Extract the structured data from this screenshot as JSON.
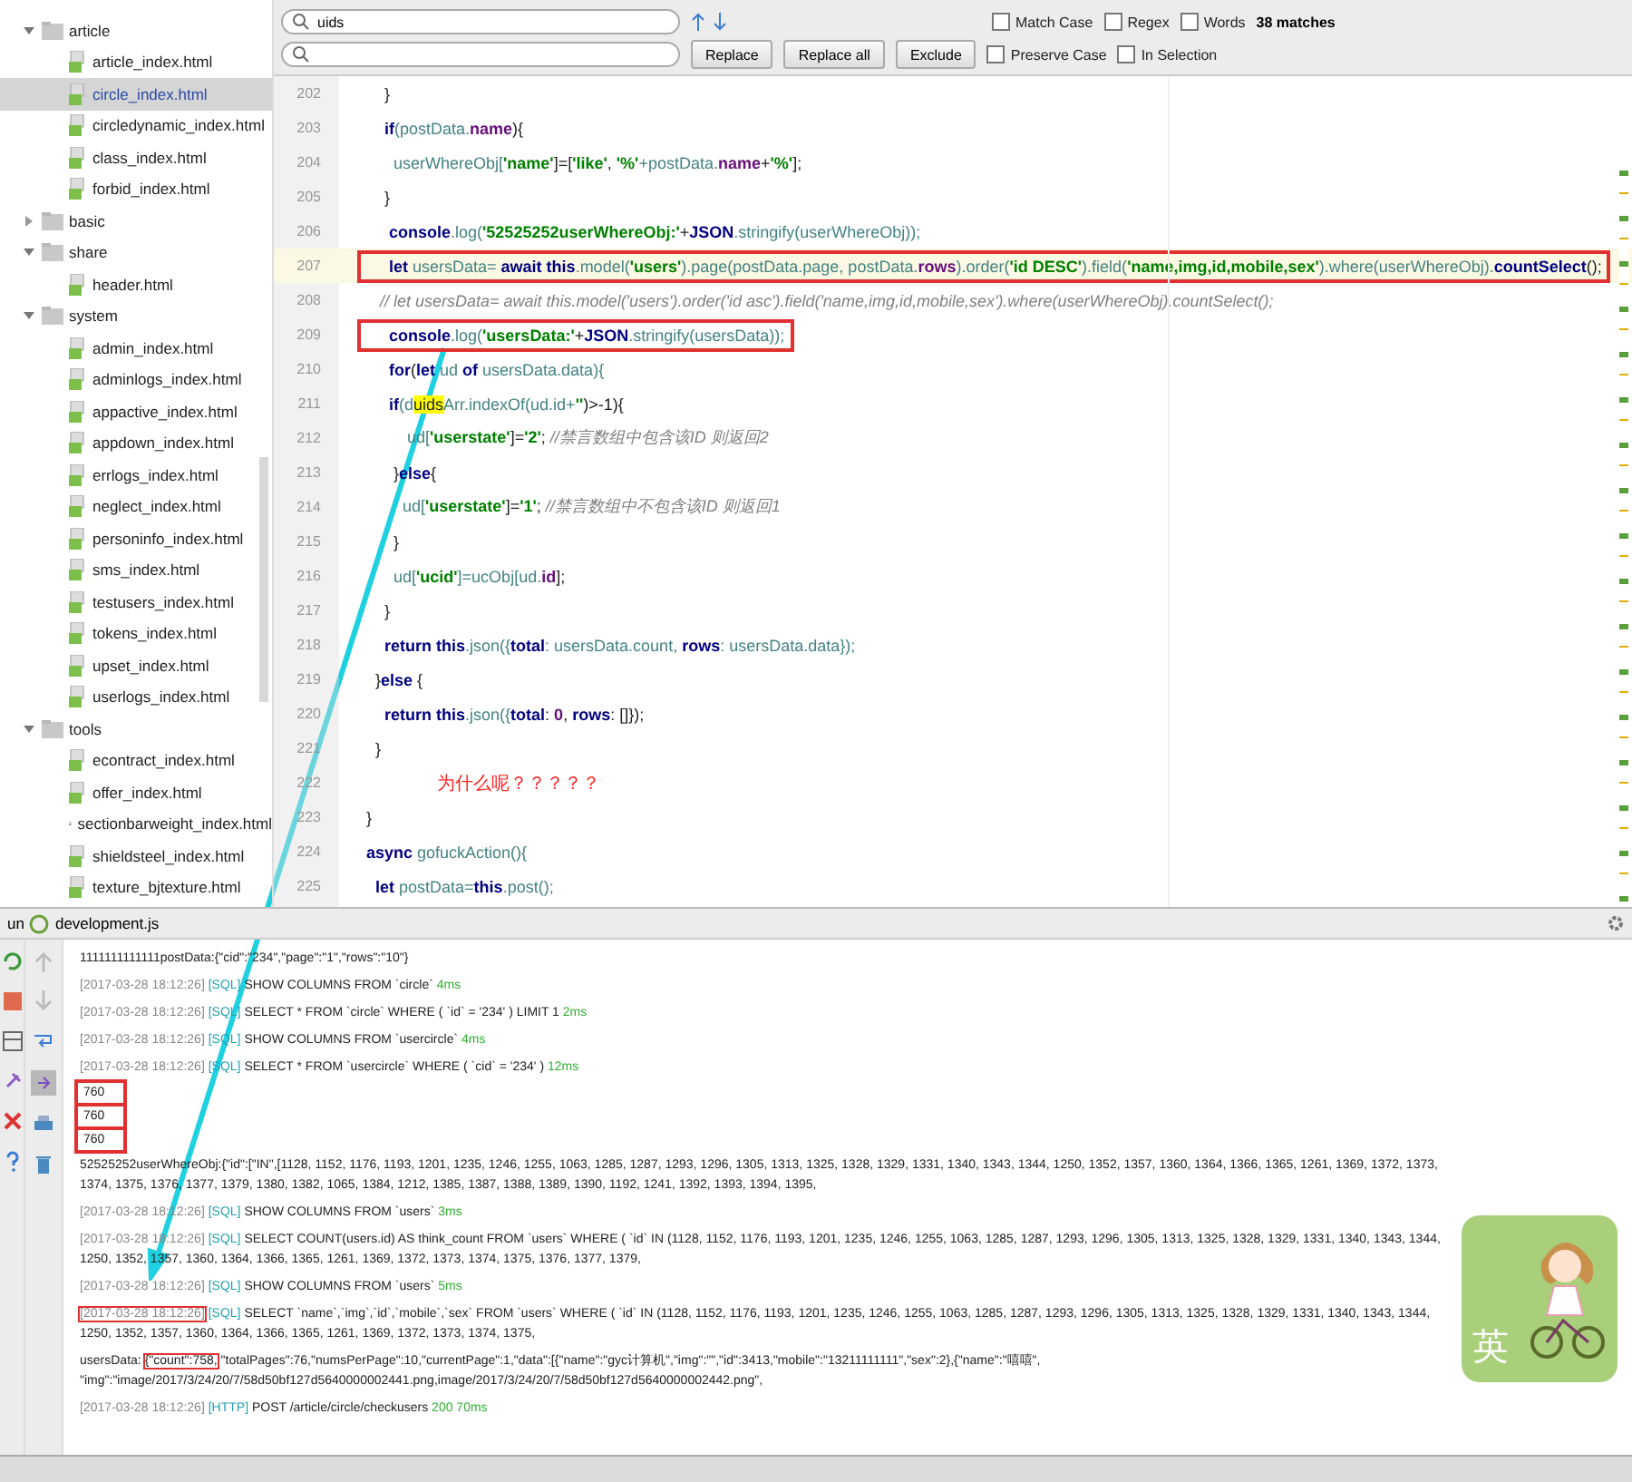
{
  "tree": [
    {
      "label": "article",
      "kind": "folder",
      "expanded": true,
      "selected": false,
      "children": [
        {
          "label": "article_index.html",
          "kind": "file",
          "selected": false
        },
        {
          "label": "circle_index.html",
          "kind": "file",
          "selected": true
        },
        {
          "label": "circledynamic_index.html",
          "kind": "file",
          "selected": false
        },
        {
          "label": "class_index.html",
          "kind": "file",
          "selected": false
        },
        {
          "label": "forbid_index.html",
          "kind": "file",
          "selected": false
        }
      ]
    },
    {
      "label": "basic",
      "kind": "folder",
      "expanded": false,
      "selected": false
    },
    {
      "label": "share",
      "kind": "folder",
      "expanded": true,
      "selected": false,
      "children": [
        {
          "label": "header.html",
          "kind": "file",
          "selected": false
        }
      ]
    },
    {
      "label": "system",
      "kind": "folder",
      "expanded": true,
      "selected": false,
      "children": [
        {
          "label": "admin_index.html",
          "kind": "file",
          "selected": false
        },
        {
          "label": "adminlogs_index.html",
          "kind": "file",
          "selected": false
        },
        {
          "label": "appactive_index.html",
          "kind": "file",
          "selected": false
        },
        {
          "label": "appdown_index.html",
          "kind": "file",
          "selected": false
        },
        {
          "label": "errlogs_index.html",
          "kind": "file",
          "selected": false
        },
        {
          "label": "neglect_index.html",
          "kind": "file",
          "selected": false
        },
        {
          "label": "personinfo_index.html",
          "kind": "file",
          "selected": false
        },
        {
          "label": "sms_index.html",
          "kind": "file",
          "selected": false
        },
        {
          "label": "testusers_index.html",
          "kind": "file",
          "selected": false
        },
        {
          "label": "tokens_index.html",
          "kind": "file",
          "selected": false
        },
        {
          "label": "upset_index.html",
          "kind": "file",
          "selected": false
        },
        {
          "label": "userlogs_index.html",
          "kind": "file",
          "selected": false
        }
      ]
    },
    {
      "label": "tools",
      "kind": "folder",
      "expanded": true,
      "selected": false,
      "children": [
        {
          "label": "econtract_index.html",
          "kind": "file",
          "selected": false
        },
        {
          "label": "offer_index.html",
          "kind": "file",
          "selected": false
        },
        {
          "label": "sectionbarweight_index.html",
          "kind": "file",
          "selected": false
        },
        {
          "label": "shieldsteel_index.html",
          "kind": "file",
          "selected": false
        },
        {
          "label": "texture_bjtexture.html",
          "kind": "file",
          "selected": false
        }
      ]
    }
  ],
  "find_bar": {
    "search": "uids",
    "options": [
      {
        "label": "Match Case",
        "checked": false
      },
      {
        "label": "Regex",
        "checked": false
      },
      {
        "label": "Words",
        "checked": false
      }
    ],
    "matches": "38 matches",
    "buttons": [
      "Replace",
      "Replace all",
      "Exclude"
    ],
    "replace_options": [
      {
        "label": "Preserve Case",
        "checked": false
      },
      {
        "label": "In Selection",
        "checked": false
      }
    ]
  },
  "code": [
    {
      "number": "202",
      "boxed": false,
      "tokens": [
        {
          "text": "    }",
          "kind": "plain"
        }
      ]
    },
    {
      "number": "203",
      "boxed": false,
      "tokens": [
        {
          "text": "    if",
          "kind": "kw"
        },
        {
          "text": "(postData.",
          "kind": "var"
        },
        {
          "text": "name",
          "kind": "prop"
        },
        {
          "text": "){",
          "kind": "plain"
        }
      ]
    },
    {
      "number": "204",
      "boxed": false,
      "tokens": [
        {
          "text": "      userWhereObj[",
          "kind": "var"
        },
        {
          "text": "'name'",
          "kind": "str"
        },
        {
          "text": "]=[",
          "kind": "plain"
        },
        {
          "text": "'like'",
          "kind": "str"
        },
        {
          "text": ", ",
          "kind": "plain"
        },
        {
          "text": "'%'",
          "kind": "str"
        },
        {
          "text": "+postData.",
          "kind": "var"
        },
        {
          "text": "name",
          "kind": "prop"
        },
        {
          "text": "+",
          "kind": "plain"
        },
        {
          "text": "'%'",
          "kind": "str"
        },
        {
          "text": "];",
          "kind": "plain"
        }
      ]
    },
    {
      "number": "205",
      "boxed": false,
      "tokens": [
        {
          "text": "    }",
          "kind": "plain"
        }
      ]
    },
    {
      "number": "206",
      "boxed": false,
      "tokens": [
        {
          "text": "     console",
          "kind": "kw"
        },
        {
          "text": ".log(",
          "kind": "var"
        },
        {
          "text": "'52525252userWhereObj:'",
          "kind": "str"
        },
        {
          "text": "+",
          "kind": "plain"
        },
        {
          "text": "JSON",
          "kind": "kw"
        },
        {
          "text": ".stringify(userWhereObj));",
          "kind": "var"
        }
      ]
    },
    {
      "number": "207",
      "boxed": true,
      "tokens": [
        {
          "text": "     let ",
          "kind": "kw"
        },
        {
          "text": "usersData= ",
          "kind": "var"
        },
        {
          "text": "await this",
          "kind": "kw"
        },
        {
          "text": ".model(",
          "kind": "var"
        },
        {
          "text": "'users'",
          "kind": "str"
        },
        {
          "text": ").page(postData.page, postData.",
          "kind": "var"
        },
        {
          "text": "rows",
          "kind": "prop"
        },
        {
          "text": ").order(",
          "kind": "var"
        },
        {
          "text": "'id DESC'",
          "kind": "str"
        },
        {
          "text": ").field(",
          "kind": "var"
        },
        {
          "text": "'name,img,id,mobile,sex'",
          "kind": "str"
        },
        {
          "text": ").where(userWhereObj).",
          "kind": "var"
        },
        {
          "text": "countSelect",
          "kind": "kw"
        },
        {
          "text": "();",
          "kind": "plain"
        }
      ]
    },
    {
      "number": "208",
      "boxed": false,
      "tokens": [
        {
          "text": "   // let usersData= await this.model('users').order('id asc').field('name,img,id,mobile,sex').where(userWhereObj).countSelect();",
          "kind": "comment"
        }
      ]
    },
    {
      "number": "209",
      "boxed": true,
      "tokens": [
        {
          "text": "     console",
          "kind": "kw"
        },
        {
          "text": ".log(",
          "kind": "var"
        },
        {
          "text": "'usersData:'",
          "kind": "str"
        },
        {
          "text": "+",
          "kind": "plain"
        },
        {
          "text": "JSON",
          "kind": "kw"
        },
        {
          "text": ".stringify(usersData));",
          "kind": "var"
        }
      ]
    },
    {
      "number": "210",
      "boxed": false,
      "tokens": [
        {
          "text": "     for",
          "kind": "kw"
        },
        {
          "text": "(",
          "kind": "plain"
        },
        {
          "text": "let ",
          "kind": "kw"
        },
        {
          "text": "ud ",
          "kind": "var"
        },
        {
          "text": "of ",
          "kind": "kw"
        },
        {
          "text": "usersData.data){",
          "kind": "var"
        }
      ]
    },
    {
      "number": "211",
      "boxed": false,
      "tokens": [
        {
          "text": "     if",
          "kind": "kw"
        },
        {
          "text": "(d",
          "kind": "var"
        },
        {
          "text": "uids",
          "kind": "match"
        },
        {
          "text": "Arr.indexOf(ud.id+",
          "kind": "var"
        },
        {
          "text": "''",
          "kind": "str"
        },
        {
          "text": ")>-1){",
          "kind": "plain"
        }
      ]
    },
    {
      "number": "212",
      "boxed": false,
      "tokens": [
        {
          "text": "         ud[",
          "kind": "var"
        },
        {
          "text": "'userstate'",
          "kind": "str"
        },
        {
          "text": "]=",
          "kind": "plain"
        },
        {
          "text": "'2'",
          "kind": "str"
        },
        {
          "text": "; ",
          "kind": "plain"
        },
        {
          "text": "//禁言数组中包含该ID 则返回2",
          "kind": "comment"
        }
      ]
    },
    {
      "number": "213",
      "boxed": false,
      "tokens": [
        {
          "text": "      }",
          "kind": "plain"
        },
        {
          "text": "else",
          "kind": "kw"
        },
        {
          "text": "{",
          "kind": "plain"
        }
      ]
    },
    {
      "number": "214",
      "boxed": false,
      "tokens": [
        {
          "text": "        ud[",
          "kind": "var"
        },
        {
          "text": "'userstate'",
          "kind": "str"
        },
        {
          "text": "]=",
          "kind": "plain"
        },
        {
          "text": "'1'",
          "kind": "str"
        },
        {
          "text": "; ",
          "kind": "plain"
        },
        {
          "text": "//禁言数组中不包含该ID 则返回1",
          "kind": "comment"
        }
      ]
    },
    {
      "number": "215",
      "boxed": false,
      "tokens": [
        {
          "text": "      }",
          "kind": "plain"
        }
      ]
    },
    {
      "number": "216",
      "boxed": false,
      "tokens": [
        {
          "text": "      ud[",
          "kind": "var"
        },
        {
          "text": "'ucid'",
          "kind": "str"
        },
        {
          "text": "]=ucObj[ud.",
          "kind": "var"
        },
        {
          "text": "id",
          "kind": "prop"
        },
        {
          "text": "];",
          "kind": "plain"
        }
      ]
    },
    {
      "number": "217",
      "boxed": false,
      "tokens": [
        {
          "text": "    }",
          "kind": "plain"
        }
      ]
    },
    {
      "number": "218",
      "boxed": false,
      "tokens": [
        {
          "text": "    return this",
          "kind": "kw"
        },
        {
          "text": ".json({",
          "kind": "var"
        },
        {
          "text": "total",
          "kind": "kw"
        },
        {
          "text": ": usersData.count, ",
          "kind": "var"
        },
        {
          "text": "rows",
          "kind": "kw"
        },
        {
          "text": ": usersData.data});",
          "kind": "var"
        }
      ]
    },
    {
      "number": "219",
      "boxed": false,
      "tokens": [
        {
          "text": "  }",
          "kind": "plain"
        },
        {
          "text": "else ",
          "kind": "kw"
        },
        {
          "text": "{",
          "kind": "plain"
        }
      ]
    },
    {
      "number": "220",
      "boxed": false,
      "tokens": [
        {
          "text": "    return this",
          "kind": "kw"
        },
        {
          "text": ".json({",
          "kind": "var"
        },
        {
          "text": "total",
          "kind": "kw"
        },
        {
          "text": ": ",
          "kind": "plain"
        },
        {
          "text": "0",
          "kind": "prop"
        },
        {
          "text": ", ",
          "kind": "plain"
        },
        {
          "text": "rows",
          "kind": "kw"
        },
        {
          "text": ": []});",
          "kind": "plain"
        }
      ]
    },
    {
      "number": "221",
      "boxed": false,
      "tokens": [
        {
          "text": "  }",
          "kind": "plain"
        }
      ]
    },
    {
      "number": "222",
      "boxed": false,
      "tokens": [
        {
          "text": "              为什么呢？？？？？",
          "kind": "note"
        }
      ]
    },
    {
      "number": "223",
      "boxed": false,
      "tokens": [
        {
          "text": "}",
          "kind": "plain"
        }
      ]
    },
    {
      "number": "224",
      "boxed": false,
      "tokens": [
        {
          "text": "async ",
          "kind": "kw"
        },
        {
          "text": "gofuckAction(){",
          "kind": "var"
        }
      ]
    },
    {
      "number": "225",
      "boxed": false,
      "tokens": [
        {
          "text": "  let ",
          "kind": "kw"
        },
        {
          "text": "postData=",
          "kind": "var"
        },
        {
          "text": "this",
          "kind": "kw"
        },
        {
          "text": ".post();",
          "kind": "var"
        }
      ]
    }
  ],
  "run_panel": {
    "tab_prefix": "un",
    "tab_title": "development.js"
  },
  "console": [
    {
      "boxed": false,
      "tokens": [
        {
          "text": "1111111111111postData:{\"cid\":\"234\",\"page\":\"1\",\"rows\":\"10\"}",
          "kind": "text"
        }
      ]
    },
    {
      "boxed": false,
      "tokens": [
        {
          "text": "[2017-03-28 18:12:26]",
          "kind": "time"
        },
        {
          "text": "[SQL]",
          "kind": "tag"
        },
        {
          "text": "SHOW COLUMNS FROM `circle`",
          "kind": "text"
        },
        {
          "text": "4ms",
          "kind": "ms"
        }
      ]
    },
    {
      "boxed": false,
      "tokens": [
        {
          "text": "[2017-03-28 18:12:26]",
          "kind": "time"
        },
        {
          "text": "[SQL]",
          "kind": "tag"
        },
        {
          "text": "SELECT * FROM `circle` WHERE ( `id` = '234' ) LIMIT 1",
          "kind": "text"
        },
        {
          "text": "2ms",
          "kind": "ms"
        }
      ]
    },
    {
      "boxed": false,
      "tokens": [
        {
          "text": "[2017-03-28 18:12:26]",
          "kind": "time"
        },
        {
          "text": "[SQL]",
          "kind": "tag"
        },
        {
          "text": "SHOW COLUMNS FROM `usercircle`",
          "kind": "text"
        },
        {
          "text": "4ms",
          "kind": "ms"
        }
      ]
    },
    {
      "boxed": false,
      "tokens": [
        {
          "text": "[2017-03-28 18:12:26]",
          "kind": "time"
        },
        {
          "text": "[SQL]",
          "kind": "tag"
        },
        {
          "text": "SELECT * FROM `usercircle` WHERE ( `cid` = '234' )",
          "kind": "text"
        },
        {
          "text": "12ms",
          "kind": "ms"
        }
      ]
    },
    {
      "boxed": true,
      "tokens": [
        {
          "text": "760",
          "kind": "text"
        }
      ]
    },
    {
      "boxed": true,
      "tokens": [
        {
          "text": "760",
          "kind": "text"
        }
      ]
    },
    {
      "boxed": true,
      "tokens": [
        {
          "text": "760",
          "kind": "text"
        }
      ]
    },
    {
      "boxed": false,
      "tokens": [
        {
          "text": "52525252userWhereObj:{\"id\":[\"IN\",[1128, 1152, 1176, 1193, 1201, 1235, 1246, 1255, 1063, 1285, 1287, 1293, 1296, 1305, 1313, 1325, 1328, 1329, 1331, 1340, 1343, 1344, 1250, 1352, 1357, 1360, 1364, 1366, 1365, 1261, 1369, 1372, 1373, 1374, 1375, 1376, 1377, 1379, 1380, 1382, 1065, 1384, 1212, 1385, 1387, 1388, 1389, 1390, 1192, 1241, 1392, 1393, 1394, 1395,",
          "kind": "text"
        }
      ]
    },
    {
      "boxed": false,
      "tokens": [
        {
          "text": "[2017-03-28 18:12:26]",
          "kind": "time"
        },
        {
          "text": "[SQL]",
          "kind": "tag"
        },
        {
          "text": "SHOW COLUMNS FROM `users`",
          "kind": "text"
        },
        {
          "text": "3ms",
          "kind": "ms"
        }
      ]
    },
    {
      "boxed": false,
      "tokens": [
        {
          "text": "[2017-03-28 18:12:26]",
          "kind": "time"
        },
        {
          "text": "[SQL]",
          "kind": "tag"
        },
        {
          "text": "SELECT COUNT(users.id) AS think_count FROM `users` WHERE ( `id` IN (1128, 1152, 1176, 1193, 1201, 1235, 1246, 1255, 1063, 1285, 1287, 1293, 1296, 1305, 1313, 1325, 1328, 1329, 1331, 1340, 1343, 1344, 1250, 1352, 1357, 1360, 1364, 1366, 1365, 1261, 1369, 1372, 1373, 1374, 1375, 1376, 1377, 1379,",
          "kind": "text"
        }
      ]
    },
    {
      "boxed": false,
      "tokens": [
        {
          "text": "[2017-03-28 18:12:26]",
          "kind": "time"
        },
        {
          "text": "[SQL]",
          "kind": "tag"
        },
        {
          "text": "SHOW COLUMNS FROM `users`",
          "kind": "text"
        },
        {
          "text": "5ms",
          "kind": "ms"
        }
      ]
    },
    {
      "boxed": false,
      "tokens": [
        {
          "text": "[2017-03-28 18:12:26]",
          "kind": "time",
          "boxed": true
        },
        {
          "text": "[SQL]",
          "kind": "tag"
        },
        {
          "text": "SELECT `name`,`img`,`id`,`mobile`,`sex` FROM `users` WHERE ( `id` IN (1128, 1152, 1176, 1193, 1201, 1235, 1246, 1255, 1063, 1285, 1287, 1293, 1296, 1305, 1313, 1325, 1328, 1329, 1331, 1340, 1343, 1344, 1250, 1352, 1357, 1360, 1364, 1366, 1365, 1261, 1369, 1372, 1373, 1374, 1375,",
          "kind": "text"
        }
      ]
    },
    {
      "boxed": false,
      "tokens": [
        {
          "text": "usersData:",
          "kind": "text"
        },
        {
          "text": "{\"count\":758,",
          "kind": "text",
          "boxed": true
        },
        {
          "text": "\"totalPages\":76,\"numsPerPage\":10,\"currentPage\":1,\"data\":[{\"name\":\"gyc计算机\",\"img\":\"\",\"id\":3413,\"mobile\":\"13211111111\",\"sex\":2},{\"name\":\"嘻嘻\",",
          "kind": "text"
        },
        {
          "text": "\"img\":\"image/2017/3/24/20/7/58d50bf127d5640000002441.png,image/2017/3/24/20/7/58d50bf127d5640000002442.png\",",
          "kind": "text"
        }
      ]
    },
    {
      "boxed": false,
      "tokens": [
        {
          "text": "[2017-03-28 18:12:26]",
          "kind": "time"
        },
        {
          "text": "[HTTP]",
          "kind": "tag"
        },
        {
          "text": "POST /article/circle/checkusers",
          "kind": "text"
        },
        {
          "text": "200 70ms",
          "kind": "ms"
        }
      ]
    }
  ],
  "ime_widget": {
    "label": "英"
  }
}
